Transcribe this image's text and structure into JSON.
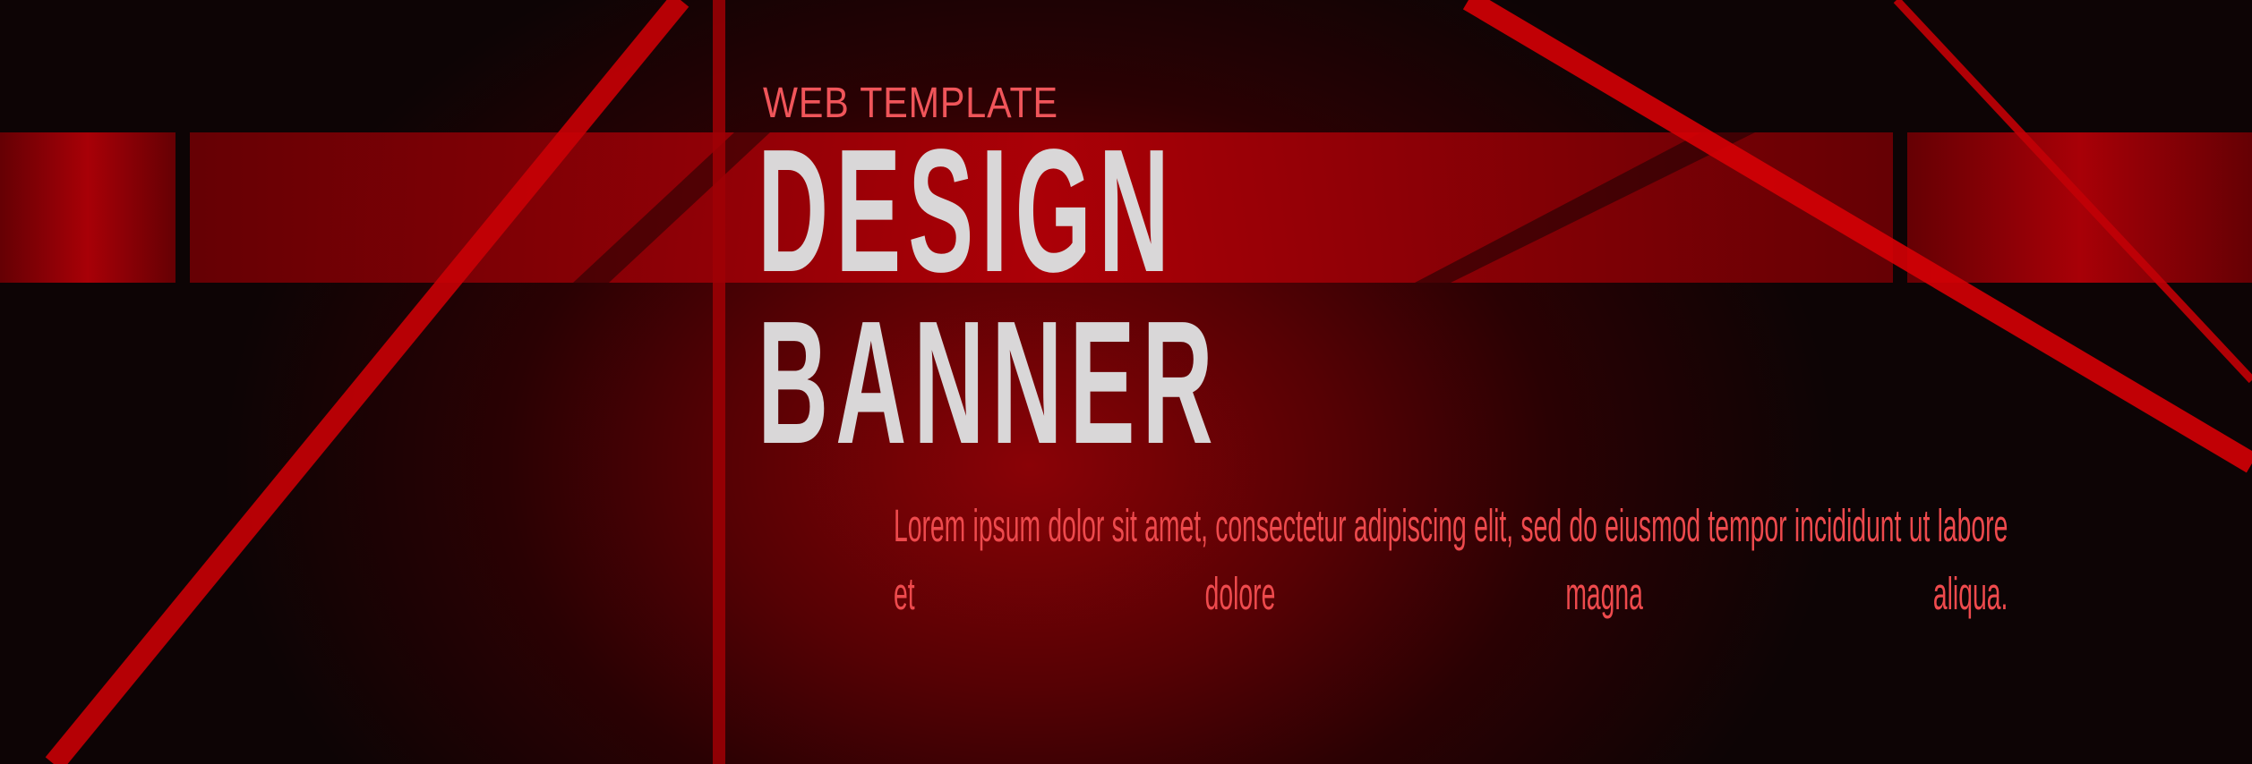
{
  "banner": {
    "eyebrow": "WEB TEMPLATE",
    "headline_line1": "DESIGN",
    "headline_line2": "BANNER",
    "body": "Lorem ipsum dolor sit amet, consectetur adipiscing elit, sed do eiusmod tempor incididunt ut labore et dolore magna aliqua."
  },
  "colors": {
    "background_dark": "#0c0405",
    "background_glow": "#8a0206",
    "accent_red": "#d40005",
    "band_red": "#9a0006",
    "headline_text": "#d9d7d8",
    "eyebrow_text": "#f0555a",
    "body_text": "#ee4a4d"
  }
}
